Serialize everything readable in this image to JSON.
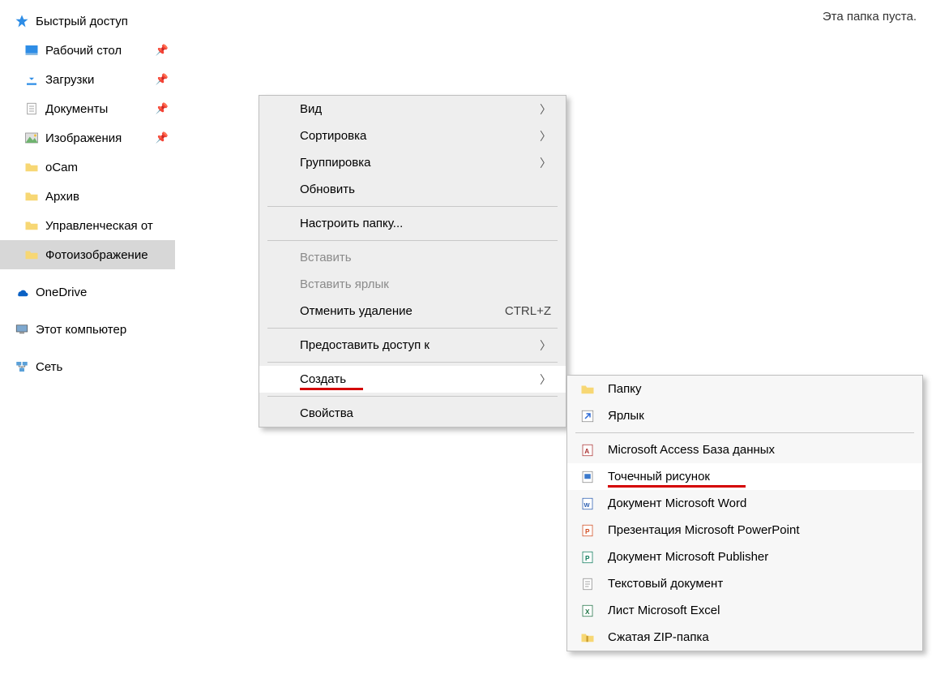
{
  "sidebar": {
    "quick_access": "Быстрый доступ",
    "desktop": "Рабочий стол",
    "downloads": "Загрузки",
    "documents": "Документы",
    "pictures": "Изображения",
    "ocam": "oCam",
    "archive": "Архив",
    "management": "Управленческая от",
    "photo": "Фотоизображение",
    "onedrive": "OneDrive",
    "this_pc": "Этот компьютер",
    "network": "Сеть"
  },
  "main": {
    "empty": "Эта папка пуста."
  },
  "context_menu": {
    "view": "Вид",
    "sort": "Сортировка",
    "group": "Группировка",
    "refresh": "Обновить",
    "customize": "Настроить папку...",
    "paste": "Вставить",
    "paste_shortcut": "Вставить ярлык",
    "undo_delete": "Отменить удаление",
    "undo_delete_key": "CTRL+Z",
    "share": "Предоставить доступ к",
    "create": "Создать",
    "properties": "Свойства"
  },
  "create_submenu": {
    "folder": "Папку",
    "shortcut": "Ярлык",
    "access": "Microsoft Access База данных",
    "bitmap": "Точечный рисунок",
    "word": "Документ Microsoft Word",
    "powerpoint": "Презентация Microsoft PowerPoint",
    "publisher": "Документ Microsoft Publisher",
    "text": "Текстовый документ",
    "excel": "Лист Microsoft Excel",
    "zip": "Сжатая ZIP-папка"
  }
}
